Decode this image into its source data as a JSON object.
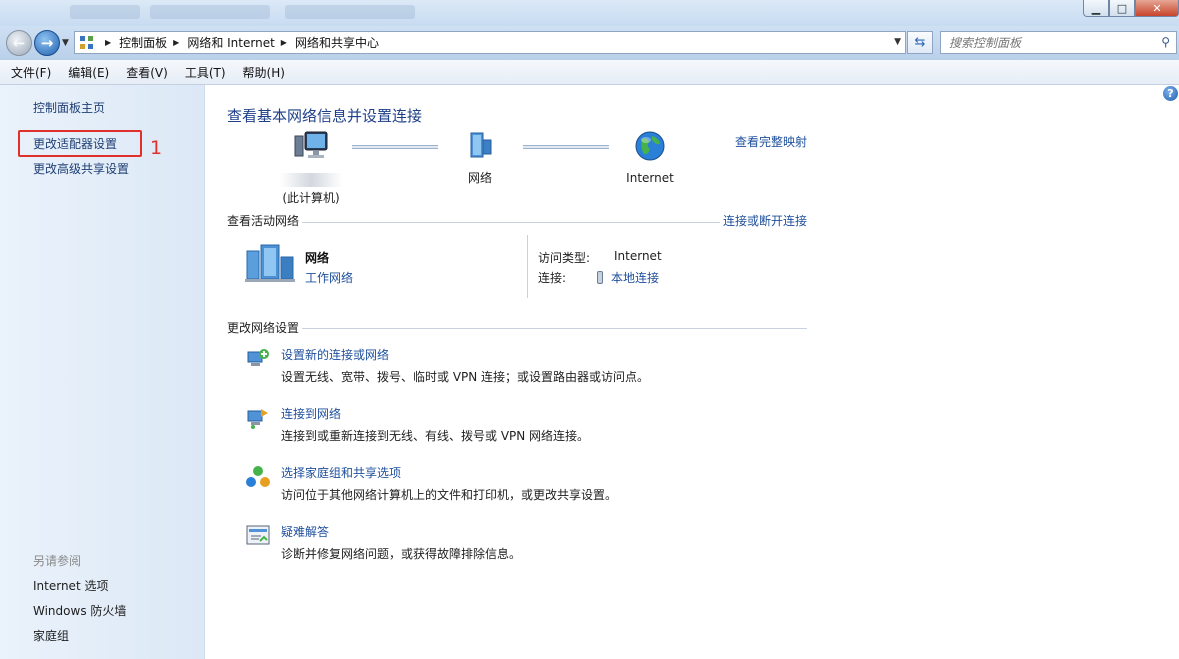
{
  "window": {
    "buttons": {
      "minimize": "▁",
      "maximize": "□",
      "close": "✕"
    }
  },
  "address_bar": {
    "crumbs": [
      "控制面板",
      "网络和 Internet",
      "网络和共享中心"
    ],
    "search_placeholder": "搜索控制面板"
  },
  "menu": [
    "文件(F)",
    "编辑(E)",
    "查看(V)",
    "工具(T)",
    "帮助(H)"
  ],
  "sidebar": {
    "links": [
      "控制面板主页",
      "更改适配器设置",
      "更改高级共享设置"
    ],
    "annotation_number": "1",
    "see_also_title": "另请参阅",
    "see_also": [
      "Internet 选项",
      "Windows 防火墙",
      "家庭组"
    ]
  },
  "main": {
    "title": "查看基本网络信息并设置连接",
    "view_full_map": "查看完整映射",
    "map_nodes": {
      "computer_caption": "(此计算机)",
      "network": "网络",
      "internet": "Internet"
    },
    "active_networks": {
      "heading": "查看活动网络",
      "connect_link": "连接或断开连接",
      "network_name": "网络",
      "network_type": "工作网络",
      "access_type_label": "访问类型:",
      "access_type_value": "Internet",
      "connection_label": "连接:",
      "connection_value": "本地连接"
    },
    "change_settings": {
      "heading": "更改网络设置",
      "tasks": [
        {
          "link": "设置新的连接或网络",
          "desc": "设置无线、宽带、拨号、临时或 VPN 连接；或设置路由器或访问点。",
          "icon": "new-connection-icon"
        },
        {
          "link": "连接到网络",
          "desc": "连接到或重新连接到无线、有线、拨号或 VPN 网络连接。",
          "icon": "connect-network-icon"
        },
        {
          "link": "选择家庭组和共享选项",
          "desc": "访问位于其他网络计算机上的文件和打印机，或更改共享设置。",
          "icon": "homegroup-icon"
        },
        {
          "link": "疑难解答",
          "desc": "诊断并修复网络问题，或获得故障排除信息。",
          "icon": "troubleshoot-icon"
        }
      ]
    }
  }
}
